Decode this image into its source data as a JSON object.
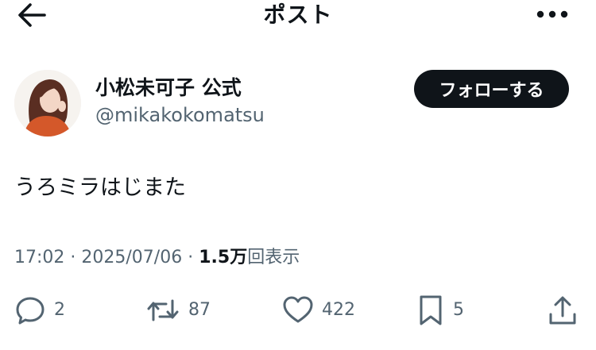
{
  "header": {
    "title": "ポスト"
  },
  "author": {
    "display_name": "小松未可子 公式",
    "handle": "@mikakokomatsu",
    "follow_label": "フォローする"
  },
  "post": {
    "text": "うろミラはじまた",
    "time": "17:02",
    "separator": "·",
    "date": "2025/07/06",
    "views_count": "1.5万",
    "views_label": "回表示"
  },
  "actions": {
    "replies": "2",
    "reposts": "87",
    "likes": "422",
    "bookmarks": "5"
  },
  "colors": {
    "text_primary": "#0f1419",
    "text_secondary": "#536471",
    "follow_button_bg": "#0f1419"
  }
}
